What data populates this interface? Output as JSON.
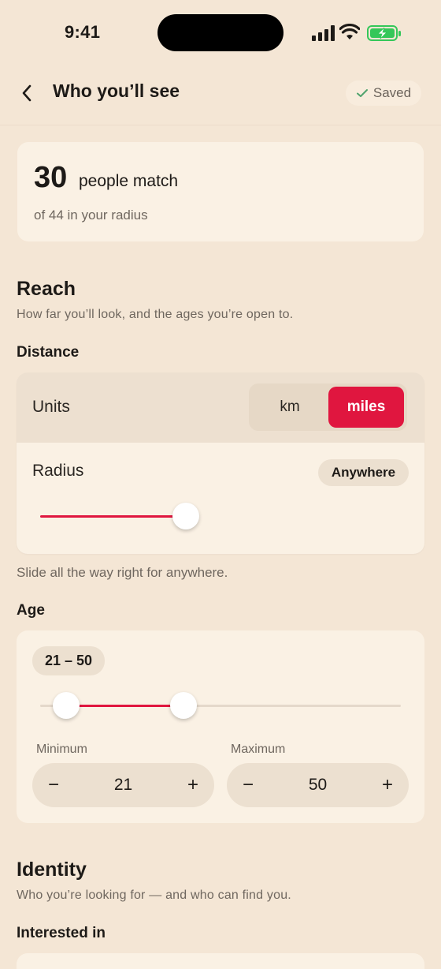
{
  "status": {
    "time": "9:41"
  },
  "nav": {
    "title": "Who you’ll see",
    "saved": "Saved"
  },
  "match": {
    "count": "30",
    "label": "people match",
    "sub": "of 44 in your radius"
  },
  "reach": {
    "title": "Reach",
    "description": "How far you’ll look, and the ages you’re open to.",
    "distance_label": "Distance",
    "units_label": "Units",
    "units_options": [
      "km",
      "miles"
    ],
    "units_selected": "miles",
    "radius_label": "Radius",
    "radius_value": "Anywhere",
    "radius_fraction": 0.4,
    "hint": "Slide all the way right for anywhere.",
    "age_label": "Age",
    "age_range": "21 – 50",
    "min_label": "Minimum",
    "min_value": "21",
    "max_label": "Maximum",
    "max_value": "50",
    "minus": "−",
    "plus": "+"
  },
  "identity": {
    "title": "Identity",
    "description": "Who you’re looking for — and who can find you.",
    "interested_label": "Interested in"
  },
  "colors": {
    "accent": "#e0163f",
    "background": "#f4e6d5",
    "card": "#faf1e4",
    "battery": "#34c759"
  }
}
